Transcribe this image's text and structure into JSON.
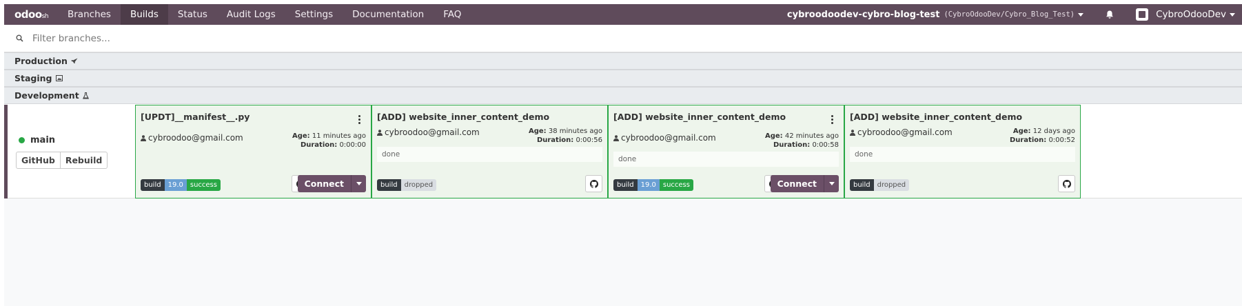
{
  "nav": {
    "logo": "odoo",
    "logo_suffix": "sh",
    "items": [
      "Branches",
      "Builds",
      "Status",
      "Audit Logs",
      "Settings",
      "Documentation",
      "FAQ"
    ],
    "active": "Builds",
    "project": "cybroodoodev-cybro-blog-test",
    "repo": "(CybroOdooDev/Cybro_Blog_Test)",
    "user": "CybroOdooDev"
  },
  "filter": {
    "placeholder": "Filter branches..."
  },
  "sections": {
    "production": "Production",
    "staging": "Staging",
    "development": "Development"
  },
  "branch": {
    "name": "main",
    "status_color": "#28a745",
    "buttons": {
      "github": "GitHub",
      "rebuild": "Rebuild"
    }
  },
  "builds": [
    {
      "title": "[UPDT]__manifest__.py",
      "author": "cybroodoo@gmail.com",
      "age_label": "Age:",
      "age": "11 minutes ago",
      "duration_label": "Duration:",
      "duration": "0:00:00",
      "log": "",
      "badges": {
        "build": "build",
        "version": "19.0",
        "status": "success"
      },
      "connect": "Connect"
    },
    {
      "title": "[ADD] website_inner_content_demo",
      "author": "cybroodoo@gmail.com",
      "age_label": "Age:",
      "age": "38 minutes ago",
      "duration_label": "Duration:",
      "duration": "0:00:56",
      "log": "done",
      "badges": {
        "build": "build",
        "status": "dropped"
      }
    },
    {
      "title": "[ADD] website_inner_content_demo",
      "author": "cybroodoo@gmail.com",
      "age_label": "Age:",
      "age": "42 minutes ago",
      "duration_label": "Duration:",
      "duration": "0:00:58",
      "log": "done",
      "badges": {
        "build": "build",
        "version": "19.0",
        "status": "success"
      },
      "connect": "Connect"
    },
    {
      "title": "[ADD] website_inner_content_demo",
      "author": "cybroodoo@gmail.com",
      "age_label": "Age:",
      "age": "12 days ago",
      "duration_label": "Duration:",
      "duration": "0:00:52",
      "log": "done",
      "badges": {
        "build": "build",
        "status": "dropped"
      }
    }
  ],
  "colors": {
    "nav_bg": "#5f4b5b",
    "success": "#28a745",
    "version": "#6a9fd4",
    "connect": "#6b4f67",
    "card_bg": "#eef5ec"
  }
}
